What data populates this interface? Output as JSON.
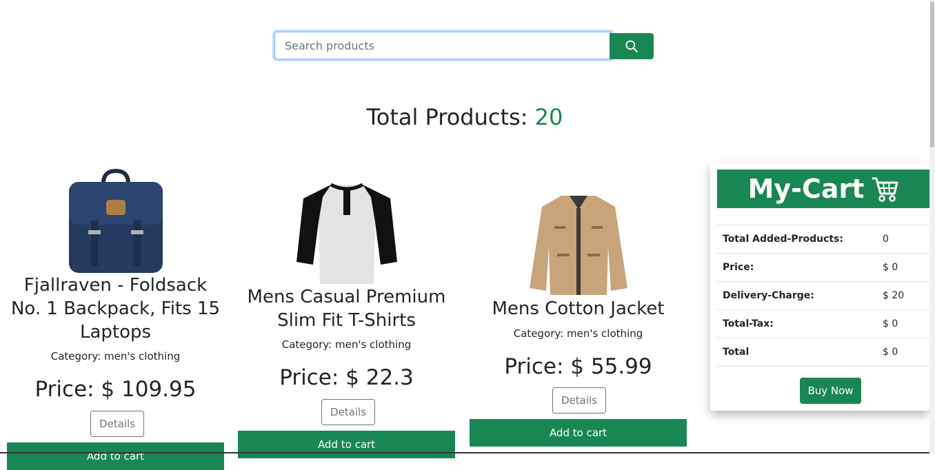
{
  "search": {
    "placeholder": "Search products",
    "value": ""
  },
  "header": {
    "total_label": "Total Products: ",
    "total_count": "20"
  },
  "products": [
    {
      "name": "Fjallraven - Foldsack No. 1 Backpack, Fits 15 Laptops",
      "category": "Category: men's clothing",
      "price": "Price: $ 109.95",
      "details_label": "Details",
      "cart_label": "Add to cart"
    },
    {
      "name": "Mens Casual Premium Slim Fit T-Shirts",
      "category": "Category: men's clothing",
      "price": "Price: $ 22.3",
      "details_label": "Details",
      "cart_label": "Add to cart"
    },
    {
      "name": "Mens Cotton Jacket",
      "category": "Category: men's clothing",
      "price": "Price: $ 55.99",
      "details_label": "Details",
      "cart_label": "Add to cart"
    }
  ],
  "cart": {
    "title": "My-Cart",
    "icon": "cart-icon",
    "rows": [
      {
        "label": "Total Added-Products:",
        "value": "0"
      },
      {
        "label": "Price:",
        "value": "$ 0"
      },
      {
        "label": "Delivery-Charge:",
        "value": "$ 20"
      },
      {
        "label": "Total-Tax:",
        "value": "$ 0"
      },
      {
        "label": "Total",
        "value": "$ 0"
      }
    ],
    "buy_label": "Buy Now"
  },
  "colors": {
    "accent": "#198754",
    "text": "#212529",
    "muted": "#6c757d"
  }
}
